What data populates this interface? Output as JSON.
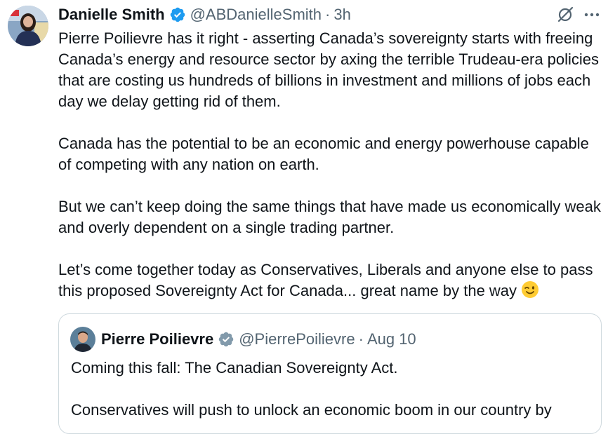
{
  "tweet": {
    "author": {
      "name": "Danielle Smith",
      "handle": "@ABDanielleSmith",
      "time": "3h",
      "separator": "·",
      "verified_icon": "verified-badge-icon",
      "avatar_icon": "avatar-photo"
    },
    "actions": {
      "grok_icon": "grok-icon",
      "more_icon": "more-icon"
    },
    "paragraphs": [
      "Pierre Poilievre has it right - asserting Canada’s sovereignty starts with freeing Canada’s energy and resource sector by axing the terrible Trudeau-era policies that are costing us hundreds of billions in investment and millions of jobs each day we delay getting rid of them.",
      "Canada has the potential to be an economic and energy powerhouse capable of competing with any nation on earth.",
      "But we can’t keep doing the same things that have made us economically weak and overly dependent on a single trading partner.",
      "Let’s come together today as Conservatives, Liberals and anyone else to pass this proposed Sovereignty Act for Canada... great name by the way"
    ],
    "emoji_icon": "winking-face-emoji"
  },
  "quoted_tweet": {
    "author": {
      "name": "Pierre Poilievre",
      "handle": "@PierrePoilievre",
      "separator": "·",
      "time": "Aug 10",
      "verified_icon": "verified-badge-gray-icon"
    },
    "paragraphs": [
      "Coming this fall: The Canadian Sovereignty Act.",
      "Conservatives will push to unlock an economic boom in our country by"
    ]
  },
  "colors": {
    "text": "#0f1419",
    "secondary": "#536471",
    "verified_blue": "#1d9bf0",
    "verified_gray": "#829aab",
    "border": "#cfd9de"
  }
}
